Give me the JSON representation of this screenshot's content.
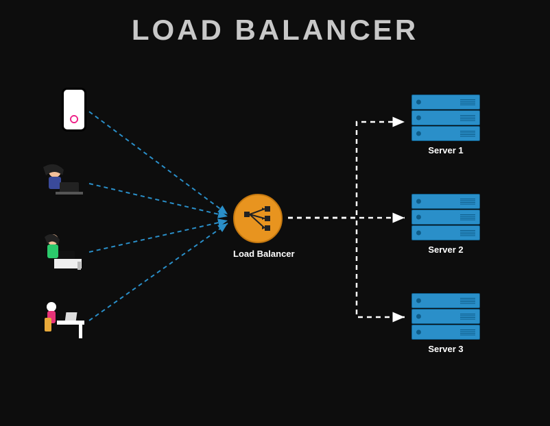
{
  "title": "LOAD BALANCER",
  "loadBalancer": {
    "label": "Load Balancer"
  },
  "servers": [
    {
      "label": "Server 1"
    },
    {
      "label": "Server 2"
    },
    {
      "label": "Server 3"
    }
  ],
  "colors": {
    "background": "#0d0d0d",
    "title": "#c8c8c8",
    "lbFill": "#e8941f",
    "serverFill": "#2a8fc9",
    "serverBorder": "#0e5d8a",
    "clientLine": "#2a8fc9",
    "serverLine": "#ffffff"
  },
  "clients": [
    {
      "type": "phone"
    },
    {
      "type": "person-laptop"
    },
    {
      "type": "person-laptop"
    },
    {
      "type": "person-desk"
    }
  ]
}
